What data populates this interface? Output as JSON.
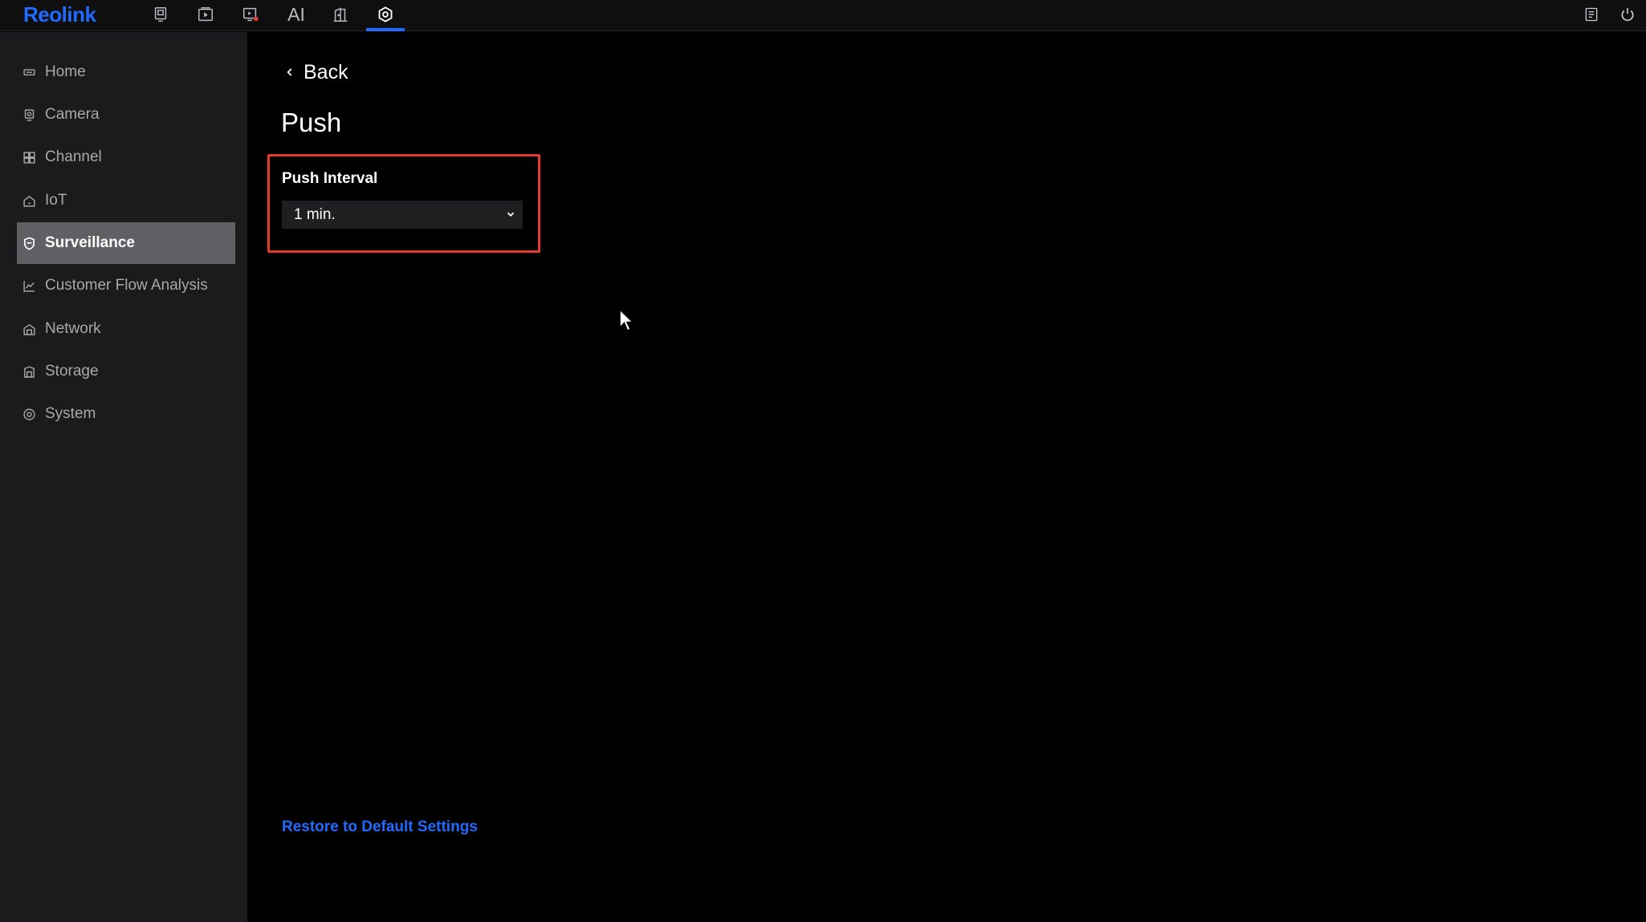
{
  "app": {
    "logo": "Reolink"
  },
  "topnav": {
    "items": [
      {
        "name": "live-view",
        "icon": "monitor-icon"
      },
      {
        "name": "playback",
        "icon": "playback-icon"
      },
      {
        "name": "alarm-playback",
        "icon": "alarm-playback-icon"
      },
      {
        "name": "ai",
        "label": "AI"
      },
      {
        "name": "doorbell",
        "icon": "door-icon"
      },
      {
        "name": "settings",
        "icon": "settings-icon",
        "active": true
      }
    ],
    "right_icons": [
      "message-icon",
      "power-icon"
    ]
  },
  "sidebar": {
    "items": [
      {
        "label": "Home",
        "icon": "home-icon"
      },
      {
        "label": "Camera",
        "icon": "camera-icon"
      },
      {
        "label": "Channel",
        "icon": "grid-icon"
      },
      {
        "label": "IoT",
        "icon": "house-icon"
      },
      {
        "label": "Surveillance",
        "icon": "shield-icon",
        "active": true
      },
      {
        "label": "Customer Flow Analysis",
        "icon": "chart-icon"
      },
      {
        "label": "Network",
        "icon": "network-icon"
      },
      {
        "label": "Storage",
        "icon": "storage-icon"
      },
      {
        "label": "System",
        "icon": "gear-icon"
      }
    ]
  },
  "main": {
    "back_label": "Back",
    "title": "Push",
    "push_interval": {
      "label": "Push Interval",
      "value": "1 min."
    },
    "restore_label": "Restore to Default Settings"
  },
  "colors": {
    "accent": "#1f6bff",
    "highlight_border": "#e8392f",
    "sidebar_bg": "#1b1b1d",
    "active_item_bg": "#5f6064"
  }
}
